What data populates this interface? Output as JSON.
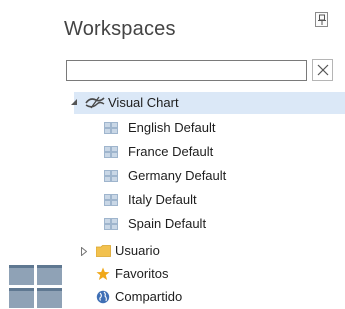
{
  "panel": {
    "title": "Workspaces",
    "search": {
      "value": "",
      "placeholder": ""
    }
  },
  "tree": {
    "root": {
      "label": "Visual Chart",
      "expanded": true,
      "selected": true,
      "icon": "visual-chart-logo-icon"
    },
    "children": [
      {
        "label": "English Default",
        "icon": "grid-layout-icon"
      },
      {
        "label": "France Default",
        "icon": "grid-layout-icon"
      },
      {
        "label": "Germany Default",
        "icon": "grid-layout-icon"
      },
      {
        "label": "Italy Default",
        "icon": "grid-layout-icon"
      },
      {
        "label": "Spain Default",
        "icon": "grid-layout-icon"
      }
    ],
    "others": [
      {
        "label": "Usuario",
        "icon": "folder-icon",
        "expanded": false
      },
      {
        "label": "Favoritos",
        "icon": "star-icon"
      },
      {
        "label": "Compartido",
        "icon": "globe-icon"
      }
    ]
  },
  "colors": {
    "selection": "#dbe8f7",
    "folder": "#f2c14e",
    "star": "#f0a81a",
    "globe": "#3f6fb5",
    "grid_icon": "#9fb5cd"
  }
}
